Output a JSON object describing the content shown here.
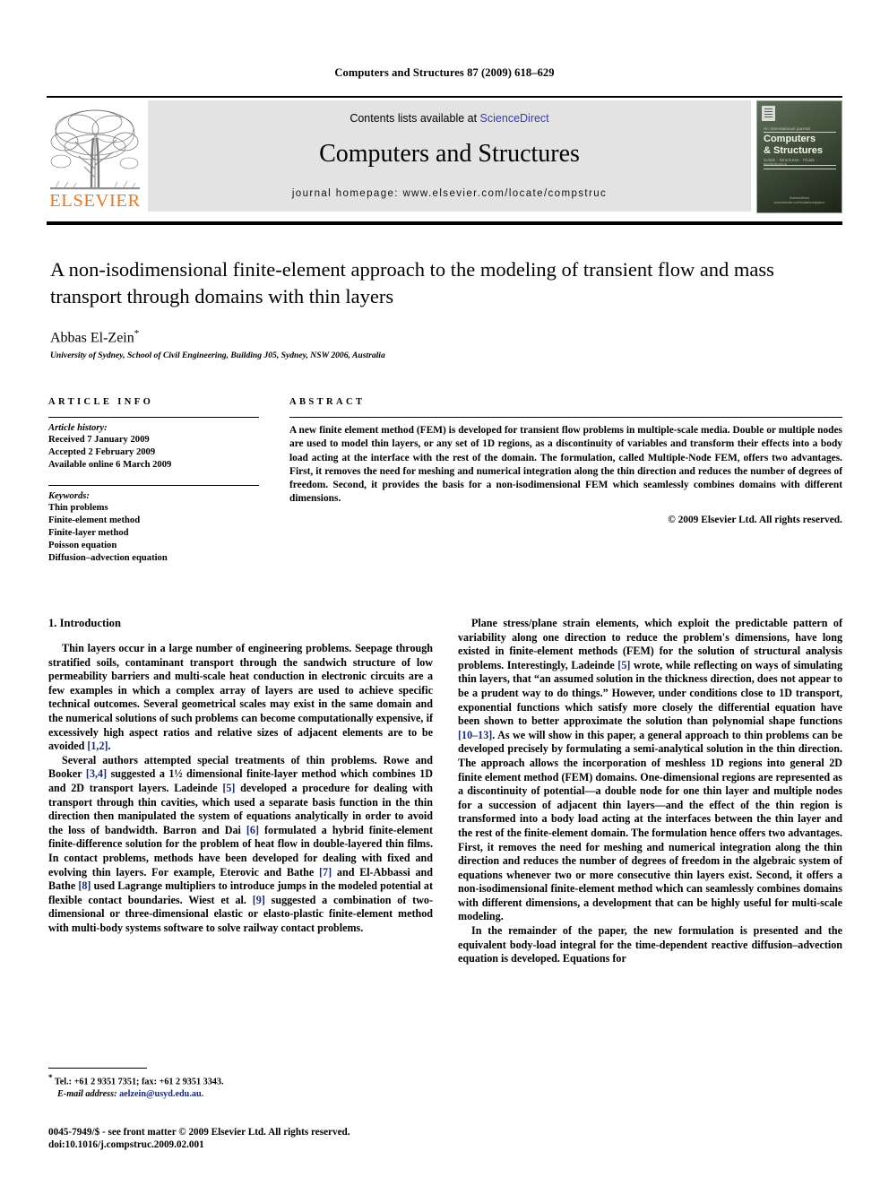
{
  "running_head": "Computers and Structures 87 (2009) 618–629",
  "masthead": {
    "publisher_wordmark": "ELSEVIER",
    "publisher_logo_icon": "elsevier-tree-logo",
    "contents_prefix": "Contents lists available at ",
    "contents_link": "ScienceDirect",
    "journal_title": "Computers and Structures",
    "homepage": "journal homepage: www.elsevier.com/locate/compstruc",
    "link_color": "#3a3ab0",
    "wordmark_color": "#E87722",
    "cover": {
      "kicker": "An international journal",
      "name_line1": "Computers",
      "name_line2": "& Structures",
      "subtitle": "Solids · Structures · Fluids · Multiphysics",
      "footer_line1": "ScienceDirect",
      "footer_line2": "www.elsevier.com/locate/compstruc"
    }
  },
  "article": {
    "title": "A non-isodimensional finite-element approach to the modeling of transient flow and mass transport through domains with thin layers",
    "author": "Abbas El-Zein",
    "author_footnote_marker": "*",
    "affiliation": "University of Sydney, School of Civil Engineering, Building J05, Sydney, NSW 2006, Australia"
  },
  "article_info": {
    "heading": "ARTICLE INFO",
    "history_label": "Article history:",
    "history": [
      "Received 7 January 2009",
      "Accepted 2 February 2009",
      "Available online 6 March 2009"
    ],
    "keywords_label": "Keywords:",
    "keywords": [
      "Thin problems",
      "Finite-element method",
      "Finite-layer method",
      "Poisson equation",
      "Diffusion–advection equation"
    ]
  },
  "abstract": {
    "heading": "ABSTRACT",
    "text": "A new finite element method (FEM) is developed for transient flow problems in multiple-scale media. Double or multiple nodes are used to model thin layers, or any set of 1D regions, as a discontinuity of variables and transform their effects into a body load acting at the interface with the rest of the domain. The formulation, called Multiple-Node FEM, offers two advantages. First, it removes the need for meshing and numerical integration along the thin direction and reduces the number of degrees of freedom. Second, it provides the basis for a non-isodimensional FEM which seamlessly combines domains with different dimensions.",
    "copyright": "© 2009 Elsevier Ltd. All rights reserved."
  },
  "body": {
    "section_heading": "1. Introduction",
    "left_paragraph_1": "Thin layers occur in a large number of engineering problems. Seepage through stratified soils, contaminant transport through the sandwich structure of low permeability barriers and multi-scale heat conduction in electronic circuits are a few examples in which a complex array of layers are used to achieve specific technical outcomes. Several geometrical scales may exist in the same domain and the numerical solutions of such problems can become computationally expensive, if excessively high aspect ratios and relative sizes of adjacent elements are to be avoided [1,2].",
    "left_paragraph_2": "Several authors attempted special treatments of thin problems. Rowe and Booker [3,4] suggested a 1½ dimensional finite-layer method which combines 1D and 2D transport layers. Ladeinde [5] developed a procedure for dealing with transport through thin cavities, which used a separate basis function in the thin direction then manipulated the system of equations analytically in order to avoid the loss of bandwidth. Barron and Dai [6] formulated a hybrid finite-element finite-difference solution for the problem of heat flow in double-layered thin films. In contact problems, methods have been developed for dealing with fixed and evolving thin layers. For example, Eterovic and Bathe [7] and El-Abbassi and Bathe [8] used Lagrange multipliers to introduce jumps in the modeled potential at flexible contact boundaries. Wiest et al. [9] suggested a combination of two-dimensional or three-dimensional elastic or elasto-plastic finite-element method with multi-body systems software to solve railway contact problems.",
    "right_paragraph_1": "Plane stress/plane strain elements, which exploit the predictable pattern of variability along one direction to reduce the problem's dimensions, have long existed in finite-element methods (FEM) for the solution of structural analysis problems. Interestingly, Ladeinde [5] wrote, while reflecting on ways of simulating thin layers, that “an assumed solution in the thickness direction, does not appear to be a prudent way to do things.” However, under conditions close to 1D transport, exponential functions which satisfy more closely the differential equation have been shown to better approximate the solution than polynomial shape functions [10–13]. As we will show in this paper, a general approach to thin problems can be developed precisely by formulating a semi-analytical solution in the thin direction. The approach allows the incorporation of meshless 1D regions into general 2D finite element method (FEM) domains. One-dimensional regions are represented as a discontinuity of potential—a double node for one thin layer and multiple nodes for a succession of adjacent thin layers—and the effect of the thin region is transformed into a body load acting at the interfaces between the thin layer and the rest of the finite-element domain. The formulation hence offers two advantages. First, it removes the need for meshing and numerical integration along the thin direction and reduces the number of degrees of freedom in the algebraic system of equations whenever two or more consecutive thin layers exist. Second, it offers a non-isodimensional finite-element method which can seamlessly combines domains with different dimensions, a development that can be highly useful for multi-scale modeling.",
    "right_paragraph_2": "In the remainder of the paper, the new formulation is presented and the equivalent body-load integral for the time-dependent reactive diffusion–advection equation is developed. Equations for"
  },
  "footnote": {
    "marker": "*",
    "contact": "Tel.: +61 2 9351 7351; fax: +61 2 9351 3343.",
    "email_label": "E-mail address:",
    "email": "aelzein@usyd.edu.au.",
    "link_color": "#1b2a7a"
  },
  "imprint": {
    "issn_line": "0045-7949/$ - see front matter © 2009 Elsevier Ltd. All rights reserved.",
    "doi_line": "doi:10.1016/j.compstruc.2009.02.001"
  }
}
